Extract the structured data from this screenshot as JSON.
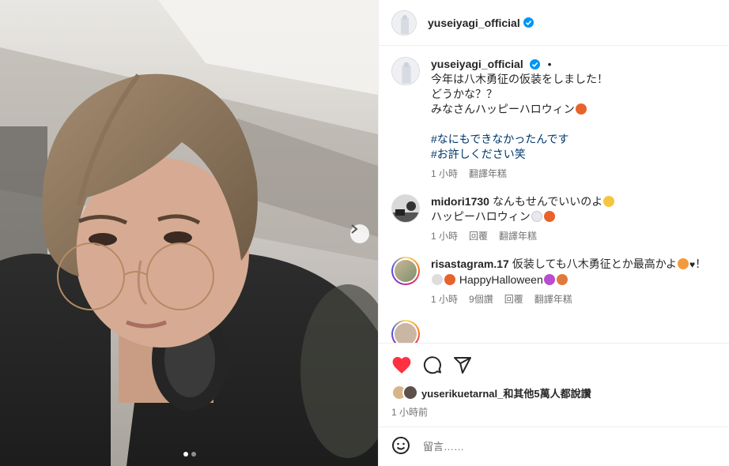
{
  "post": {
    "username": "yuseiyagi_official",
    "dot": "•",
    "caption_lines": [
      "今年は八木勇征の仮装をしました！",
      "どうかな？？",
      "みなさんハッピーハロウィン"
    ],
    "hashtags": [
      "#なにもできなかったんです",
      "#お許しください笑"
    ],
    "time": "1 小時",
    "translate": "翻譯年糕"
  },
  "comments": [
    {
      "username": "midori1730",
      "text_line1": "なんもせんでいいのよ",
      "text_line2": "ハッピーハロウィン",
      "time": "1 小時",
      "reply": "回覆",
      "translate": "翻譯年糕"
    },
    {
      "username": "risastagram.17",
      "text_line1": "仮装しても八木勇征とか最高かよ",
      "text_line1_end": "！",
      "text_line2": "HappyHalloween",
      "time": "1 小時",
      "likes": "9個讚",
      "reply": "回覆",
      "translate": "翻譯年糕"
    }
  ],
  "likes_text": "yuserikuetarnal_和其他5萬人都說讚",
  "posted_ago": "1 小時前",
  "comment_placeholder": "留言……",
  "icons": [
    "heart-filled-icon",
    "comment-icon",
    "share-icon",
    "emoji-icon",
    "verified-icon",
    "chevron-right-icon"
  ],
  "colors": {
    "like_red": "#ff3040",
    "verified_blue": "#0095f6",
    "link_blue": "#00376b",
    "meta_gray": "#737373"
  },
  "carousel": {
    "current": 1,
    "total": 2
  }
}
